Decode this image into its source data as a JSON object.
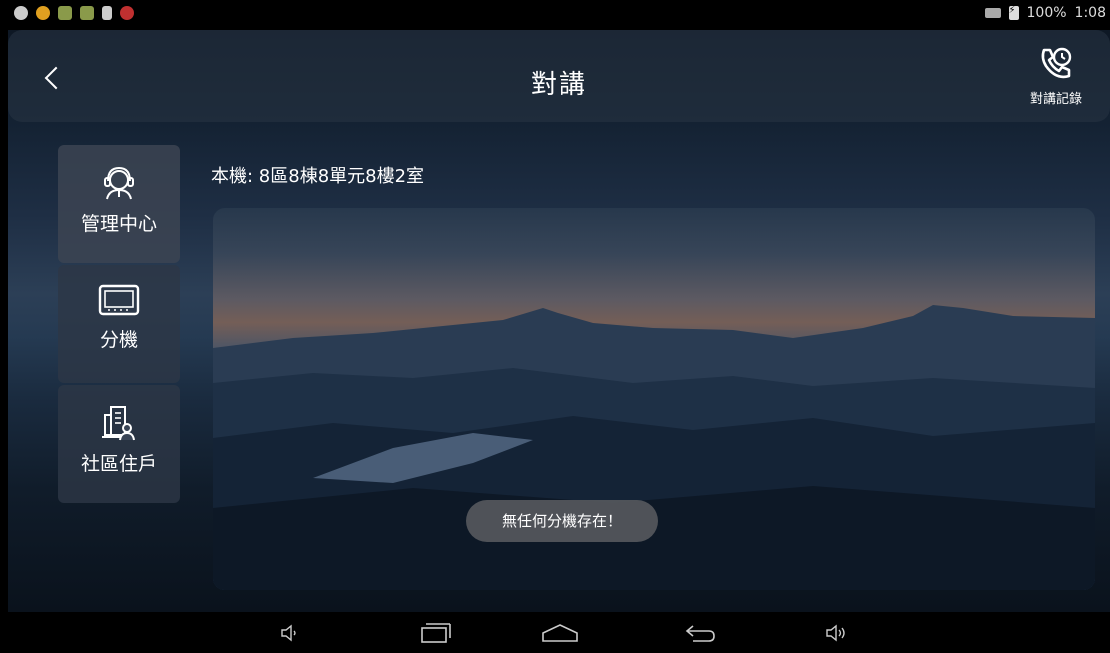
{
  "status_bar": {
    "battery_percent": "100%",
    "time": "1:08",
    "left_icons": [
      "sync-icon",
      "app-icon",
      "app-icon",
      "app-icon",
      "signal-icon",
      "alert-icon"
    ],
    "right_icons": [
      "network-icon",
      "battery-icon"
    ]
  },
  "header": {
    "title": "對講",
    "back_icon": "chevron-left-icon",
    "history_label": "對講記錄",
    "history_icon": "phone-clock-icon"
  },
  "sidebar": {
    "items": [
      {
        "label": "管理中心",
        "icon": "operator-headset-icon"
      },
      {
        "label": "分機",
        "icon": "monitor-icon"
      },
      {
        "label": "社區住戶",
        "icon": "building-residents-icon"
      }
    ]
  },
  "main": {
    "local_device": "本機: 8區8棟8單元8樓2室"
  },
  "toast": {
    "message": "無任何分機存在！"
  },
  "nav_bar": {
    "buttons": [
      "volume-down-icon",
      "recent-apps-icon",
      "home-icon",
      "back-icon",
      "volume-up-icon"
    ]
  },
  "colors": {
    "topbar": "#283444",
    "sidebar": "#2d3746",
    "toast": "#55585c"
  }
}
